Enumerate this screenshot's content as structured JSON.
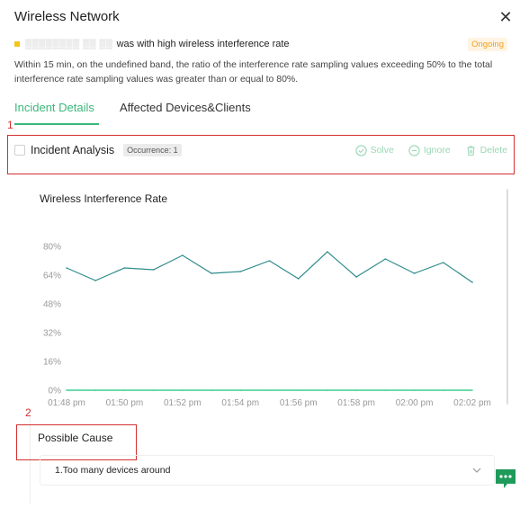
{
  "dialog": {
    "title": "Wireless Network",
    "close_label": "✕"
  },
  "incident": {
    "device_redacted": "▒▒▒▒▒▒▒▒ ▒▒ ▒▒",
    "headline": "was with high wireless interference rate",
    "status": "Ongoing",
    "severity_color": "#f5c518",
    "description": "Within 15 min, on the undefined band, the ratio of the interference rate sampling values exceeding 50% to the total interference rate sampling values was greater than or equal to 80%."
  },
  "tabs": [
    {
      "label": "Incident Details",
      "active": true
    },
    {
      "label": "Affected Devices&Clients",
      "active": false
    }
  ],
  "annotations": [
    "1",
    "2"
  ],
  "analysis": {
    "label": "Incident Analysis",
    "occurrence": "Occurrence: 1",
    "actions": {
      "solve": "Solve",
      "ignore": "Ignore",
      "delete": "Delete"
    }
  },
  "chart_data": {
    "type": "line",
    "title": "Wireless Interference Rate",
    "xlabel": "",
    "ylabel": "",
    "ylim": [
      0,
      80
    ],
    "yticks": [
      "0%",
      "16%",
      "32%",
      "48%",
      "64%",
      "80%"
    ],
    "xticks": [
      "01:48 pm",
      "01:50 pm",
      "01:52 pm",
      "01:54 pm",
      "01:56 pm",
      "01:58 pm",
      "02:00 pm",
      "02:02 pm"
    ],
    "x": [
      "01:48 pm",
      "01:49 pm",
      "01:50 pm",
      "01:51 pm",
      "01:52 pm",
      "01:53 pm",
      "01:54 pm",
      "01:55 pm",
      "01:56 pm",
      "01:57 pm",
      "01:58 pm",
      "01:59 pm",
      "02:00 pm",
      "02:01 pm",
      "02:02 pm"
    ],
    "series": [
      {
        "values": [
          68,
          61,
          68,
          67,
          75,
          65,
          66,
          72,
          62,
          77,
          63,
          73,
          65,
          71,
          60
        ],
        "color": "#2e8b8b"
      },
      {
        "values": [
          0,
          0,
          0,
          0,
          0,
          0,
          0,
          0,
          0,
          0,
          0,
          0,
          0,
          0,
          0
        ],
        "color": "#3bd18f"
      }
    ],
    "grid": false,
    "legend": "none"
  },
  "possible_cause": {
    "title": "Possible Cause",
    "items": [
      "1.Too many devices around"
    ]
  },
  "colors": {
    "accent": "#3bb87b",
    "annotation": "#d32f2f",
    "status": "#f0a020"
  }
}
